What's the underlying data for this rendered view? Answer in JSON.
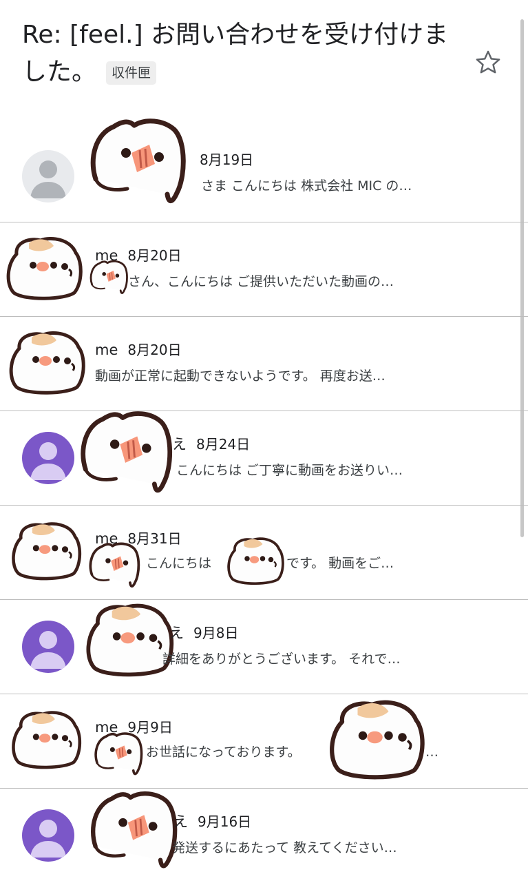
{
  "email": {
    "subject": "Re: [feel.] お問い合わせを受け付けました。",
    "label": "収件匣",
    "star_icon": "star-outline-icon"
  },
  "colors": {
    "avatar_gray": "#e8eaed",
    "avatar_purple": "#7b57c8",
    "text": "#202124",
    "snippet": "#3c4043",
    "divider": "#bdbdbd"
  },
  "messages": [
    {
      "sender": "",
      "date": "8月19日",
      "snippet": "さま こんにちは 株式会社 MIC の…",
      "avatar": "gray-person"
    },
    {
      "sender": "me",
      "date": "8月20日",
      "snippet": "さん、こんにちは ご提供いただいた動画の…",
      "avatar": "sticker"
    },
    {
      "sender": "me",
      "date": "8月20日",
      "snippet": "動画が正常に起動できないようです。 再度お送…",
      "avatar": "sticker"
    },
    {
      "sender": "え",
      "date": "8月24日",
      "snippet": "こんにちは ご丁寧に動画をお送りい…",
      "avatar": "purple-person"
    },
    {
      "sender": "me",
      "date": "8月31日",
      "snippet": "こんにちは",
      "snippet2": "です。 動画をご…",
      "avatar": "sticker"
    },
    {
      "sender": "え",
      "date": "9月8日",
      "snippet": "詳細をありがとうございます。 それで…",
      "avatar": "purple-person"
    },
    {
      "sender": "me",
      "date": "9月9日",
      "snippet": "お世話になっております。",
      "snippet2": "…",
      "avatar": "sticker"
    },
    {
      "sender": "え",
      "date": "9月16日",
      "snippet": "発送するにあたって 教えてください…",
      "avatar": "purple-person"
    }
  ]
}
